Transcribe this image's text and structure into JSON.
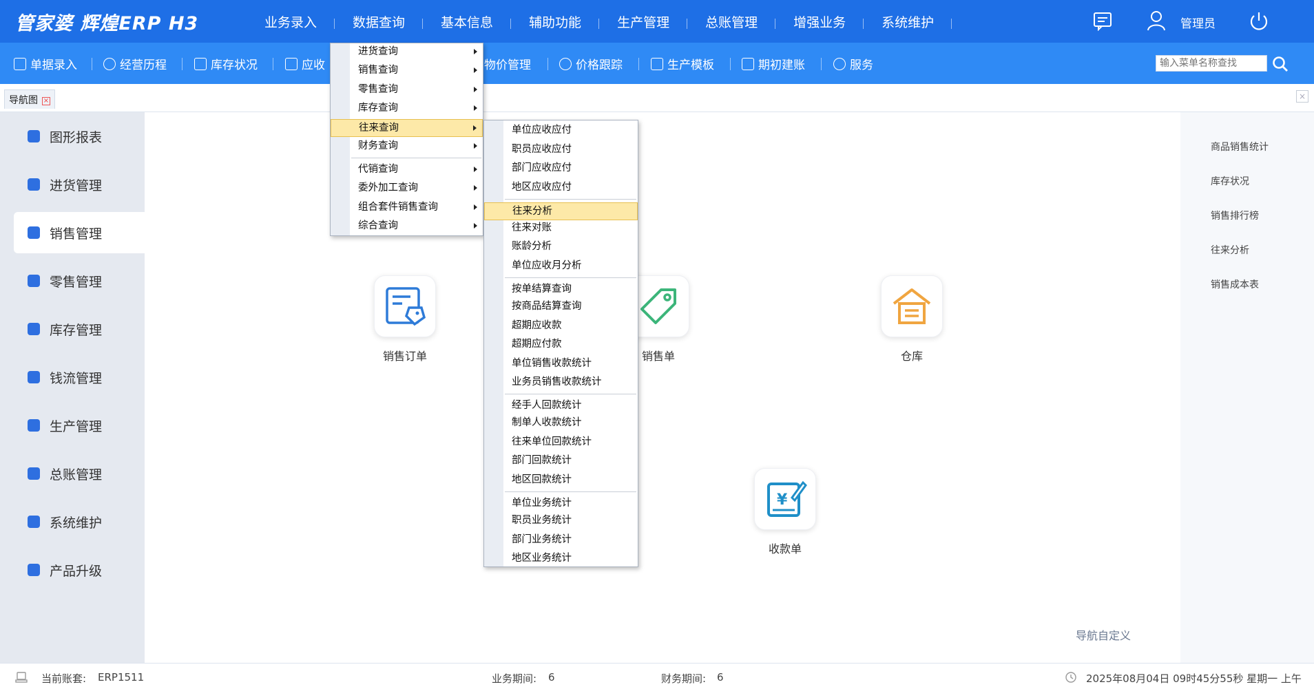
{
  "app": {
    "logo": "管家婆 辉煌ERP H3"
  },
  "topnav": [
    "业务录入",
    "数据查询",
    "基本信息",
    "辅助功能",
    "生产管理",
    "总账管理",
    "增强业务",
    "系统维护"
  ],
  "user": {
    "label": "管理员"
  },
  "toolbar": {
    "items": [
      "单据录入",
      "经营历程",
      "库存状况",
      "应收",
      "物价管理",
      "价格跟踪",
      "生产模板",
      "期初建账",
      "服务"
    ],
    "search_placeholder": "输入菜单名称查找"
  },
  "tabs": [
    {
      "label": "导航图"
    }
  ],
  "sidebar": {
    "items": [
      "图形报表",
      "进货管理",
      "销售管理",
      "零售管理",
      "库存管理",
      "钱流管理",
      "生产管理",
      "总账管理",
      "系统维护",
      "产品升级"
    ],
    "active_index": 2
  },
  "tiles": [
    "销售订单",
    "销售单",
    "仓库",
    "收款单"
  ],
  "right_panel": [
    "商品销售统计",
    "库存状况",
    "销售排行榜",
    "往来分析",
    "销售成本表"
  ],
  "nav_custom": "导航自定义",
  "statusbar": {
    "account_label": "当前账套:",
    "account_value": "ERP1511",
    "biz_period_label": "业务期间:",
    "biz_period_value": "6",
    "fin_period_label": "财务期间:",
    "fin_period_value": "6",
    "datetime": "2025年08月04日 09时45分55秒 星期一 上午"
  },
  "menu1": {
    "items": [
      "进货查询",
      "销售查询",
      "零售查询",
      "库存查询",
      "往来查询",
      "财务查询",
      "代销查询",
      "委外加工查询",
      "组合套件销售查询",
      "综合查询"
    ],
    "highlighted_index": 4
  },
  "menu2": {
    "groups": [
      [
        "单位应收应付",
        "职员应收应付",
        "部门应收应付",
        "地区应收应付"
      ],
      [
        "往来分析",
        "往来对账",
        "账龄分析",
        "单位应收月分析"
      ],
      [
        "按单结算查询",
        "按商品结算查询",
        "超期应收款",
        "超期应付款",
        "单位销售收款统计",
        "业务员销售收款统计"
      ],
      [
        "经手人回款统计",
        "制单人收款统计",
        "往来单位回款统计",
        "部门回款统计",
        "地区回款统计"
      ],
      [
        "单位业务统计",
        "职员业务统计",
        "部门业务统计",
        "地区业务统计"
      ]
    ],
    "highlighted": "往来分析"
  },
  "colors": {
    "header": "#1e6fe6",
    "toolbar": "#2f8af5",
    "sidebar": "#e5e9f0",
    "accent": "#2e6fe0",
    "menu_highlight": "#fde9a8"
  },
  "icons": {
    "tile_order": "order-tag-icon",
    "tile_sale": "price-tag-icon",
    "tile_warehouse": "warehouse-icon",
    "tile_receipt": "receipt-icon"
  }
}
